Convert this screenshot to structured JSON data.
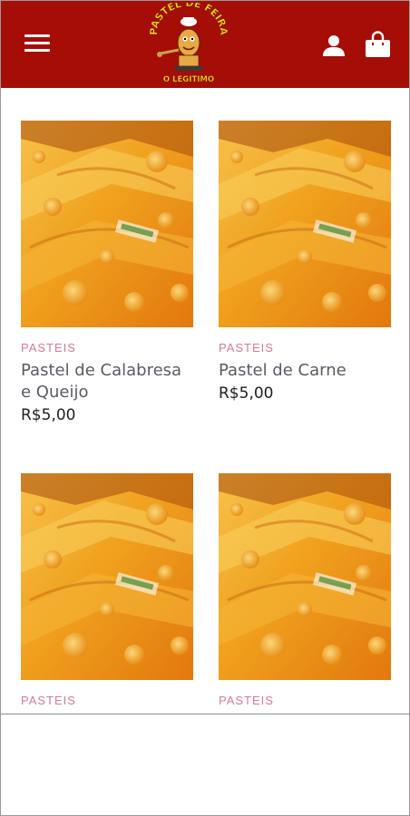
{
  "header": {
    "logo": {
      "top_text": "PASTEL DE FEIRA",
      "bottom_text": "O LEGITIMO"
    },
    "menu_icon": "hamburger-menu-icon",
    "account_icon": "user-icon",
    "cart_icon": "shopping-bag-icon",
    "colors": {
      "background": "#a50d07",
      "icons": "#ffffff"
    }
  },
  "products": [
    {
      "category": "PASTEIS",
      "name": "Pastel de Calabresa e Queijo",
      "price": "R$5,00"
    },
    {
      "category": "PASTEIS",
      "name": "Pastel de Carne",
      "price": "R$5,00"
    },
    {
      "category": "PASTEIS",
      "name": "",
      "price": ""
    },
    {
      "category": "PASTEIS",
      "name": "",
      "price": ""
    }
  ],
  "colors": {
    "category": "#d27c95",
    "product_name": "#5a5a66",
    "price": "#1f1f1f"
  }
}
